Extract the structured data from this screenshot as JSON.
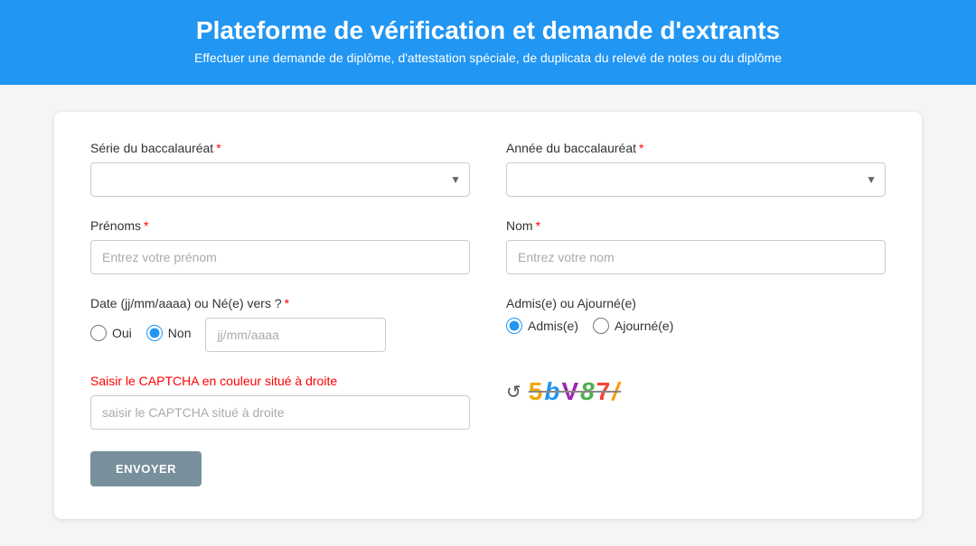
{
  "header": {
    "title": "Plateforme de vérification et demande d'extrants",
    "subtitle": "Effectuer une demande de diplôme, d'attestation spéciale, de duplicata du relevé de notes ou du diplôme"
  },
  "form": {
    "serie_label": "Série du baccalauréat",
    "annee_label": "Année du baccalauréat",
    "prenoms_label": "Prénoms",
    "prenoms_placeholder": "Entrez votre prénom",
    "nom_label": "Nom",
    "nom_placeholder": "Entrez votre nom",
    "date_label": "Date (jj/mm/aaaa) ou Né(e) vers ?",
    "date_placeholder": "jj/mm/aaaa",
    "oui_label": "Oui",
    "non_label": "Non",
    "admis_label": "Admis(e) ou Ajourné(e)",
    "admis_option": "Admis(e)",
    "ajourn_option": "Ajourné(e)",
    "captcha_error": "Saisir le CAPTCHA en couleur situé à droite",
    "captcha_placeholder": "saisir le CAPTCHA situé à droite",
    "captcha_chars": [
      "5",
      "b",
      "V",
      "8",
      "7",
      "/"
    ],
    "envoyer_label": "ENVOYER"
  }
}
